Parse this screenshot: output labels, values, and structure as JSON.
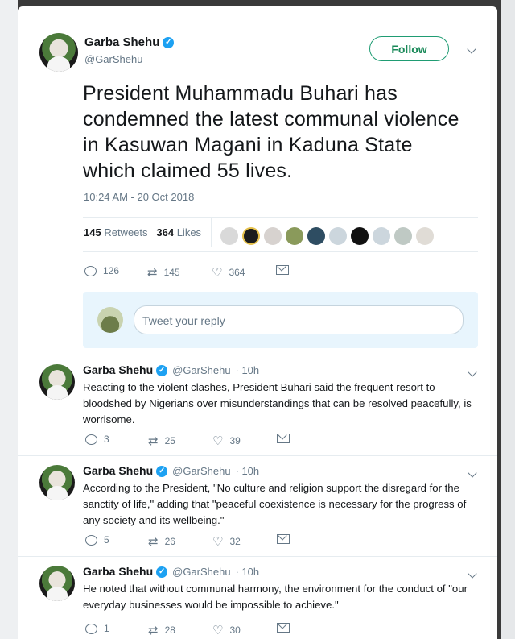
{
  "main_tweet": {
    "display_name": "Garba Shehu",
    "handle": "@GarShehu",
    "follow_label": "Follow",
    "text": "President Muhammadu Buhari has condemned the latest communal violence in Kasuwan Magani in Kaduna State which claimed 55 lives.",
    "timestamp": "10:24 AM - 20 Oct 2018",
    "retweets_count": "145",
    "retweets_label": "Retweets",
    "likes_count": "364",
    "likes_label": "Likes",
    "actions": {
      "replies": "126",
      "retweets": "145",
      "likes": "364"
    }
  },
  "reply_box": {
    "placeholder": "Tweet your reply"
  },
  "replies": [
    {
      "display_name": "Garba Shehu",
      "handle": "@GarShehu",
      "time": "· 10h",
      "text": "Reacting to the violent clashes, President Buhari said the frequent resort to bloodshed by Nigerians over misunderstandings that can be resolved peacefully, is worrisome.",
      "replies": "3",
      "retweets": "25",
      "likes": "39"
    },
    {
      "display_name": "Garba Shehu",
      "handle": "@GarShehu",
      "time": "· 10h",
      "text": "According to the President, \"No culture and religion support the disregard for the sanctity of life,\" adding that \"peaceful coexistence is necessary for the progress of any society and its wellbeing.\"",
      "replies": "5",
      "retweets": "26",
      "likes": "32"
    },
    {
      "display_name": "Garba Shehu",
      "handle": "@GarShehu",
      "time": "· 10h",
      "text": "He noted that without communal harmony, the environment for the conduct of \"our everyday businesses would be impossible to achieve.\"",
      "replies": "1",
      "retweets": "28",
      "likes": "30"
    }
  ],
  "colors": {
    "verified": "#1da1f2",
    "follow": "#1b8a5a",
    "muted": "#657786",
    "reply_bg": "#e8f5fd"
  },
  "icons": [
    "verified-icon",
    "chevron-down-icon",
    "reply-icon",
    "retweet-icon",
    "like-icon",
    "direct-message-icon"
  ]
}
